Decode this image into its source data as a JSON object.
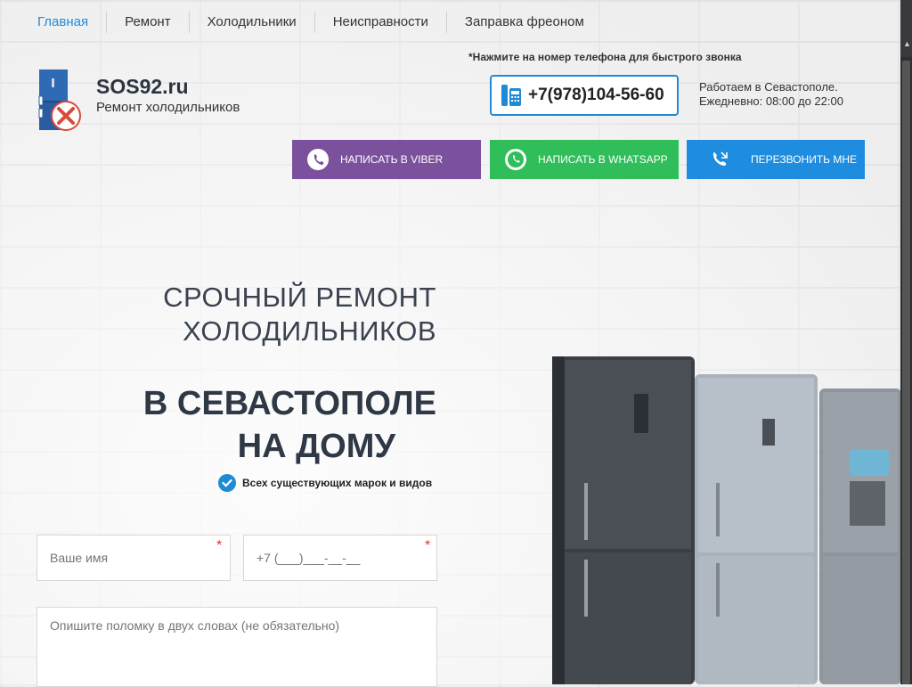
{
  "nav": {
    "items": [
      "Главная",
      "Ремонт",
      "Холодильники",
      "Неисправности",
      "Заправка фреоном"
    ]
  },
  "logo": {
    "site_name": "SOS92.ru",
    "tagline": "Ремонт холодильников"
  },
  "contact": {
    "call_hint": "*Нажмите на номер телефона для быстрого звонка",
    "phone": "+7(978)104-56-60",
    "hours_line1": "Работаем в Севастополе.",
    "hours_line2": "Ежедневно: 08:00 до 22:00"
  },
  "buttons": {
    "viber": "НАПИСАТЬ В VIBER",
    "whatsapp": "НАПИСАТЬ В WHATSAPP",
    "callback": "ПЕРЕЗВОНИТЬ МНЕ"
  },
  "hero": {
    "line1": "СРОЧНЫЙ РЕМОНТ",
    "line2": "ХОЛОДИЛЬНИКОВ",
    "big1": "В СЕВАСТОПОЛЕ",
    "big2": "НА ДОМУ",
    "check_text": "Всех существующих марок и видов"
  },
  "form": {
    "name_placeholder": "Ваше имя",
    "phone_placeholder": "+7 (___)___-__-__",
    "desc_placeholder": "Опишите поломку в двух словах (не обязательно)",
    "required_mark": "*"
  },
  "colors": {
    "accent": "#1f8ad6",
    "viber": "#7b519d",
    "whatsapp": "#2fbe5a",
    "call": "#1e8de0"
  }
}
